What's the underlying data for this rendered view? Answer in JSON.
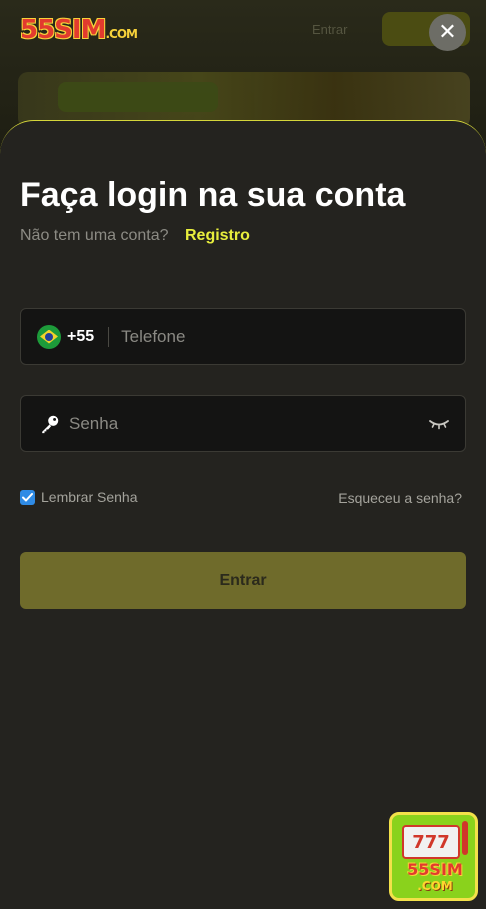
{
  "background": {
    "logo": {
      "brand": "55SIM",
      "suffix": ".COM"
    },
    "header_link": "Entrar"
  },
  "modal": {
    "title": "Faça login na sua conta",
    "no_account_text": "Não tem uma conta?",
    "register_link": "Registro",
    "phone": {
      "flag_icon": "brazil-flag-icon",
      "country_code": "+55",
      "placeholder": "Telefone",
      "value": ""
    },
    "password": {
      "key_icon": "key-icon",
      "placeholder": "Senha",
      "value": "",
      "toggle_icon": "eye-closed-icon"
    },
    "remember_label": "Lembrar Senha",
    "remember_checked": true,
    "forgot_link": "Esqueceu a senha?",
    "submit_label": "Entrar",
    "close_icon": "close-icon"
  },
  "floating_badge": {
    "reels": "777",
    "brand": "55SIM",
    "suffix": ".COM"
  },
  "colors": {
    "accent": "#e8ee3d",
    "sheet_bg": "#24231f",
    "field_bg": "#141413",
    "submit_bg": "#6f6b2b",
    "checkbox": "#2f8be5"
  }
}
